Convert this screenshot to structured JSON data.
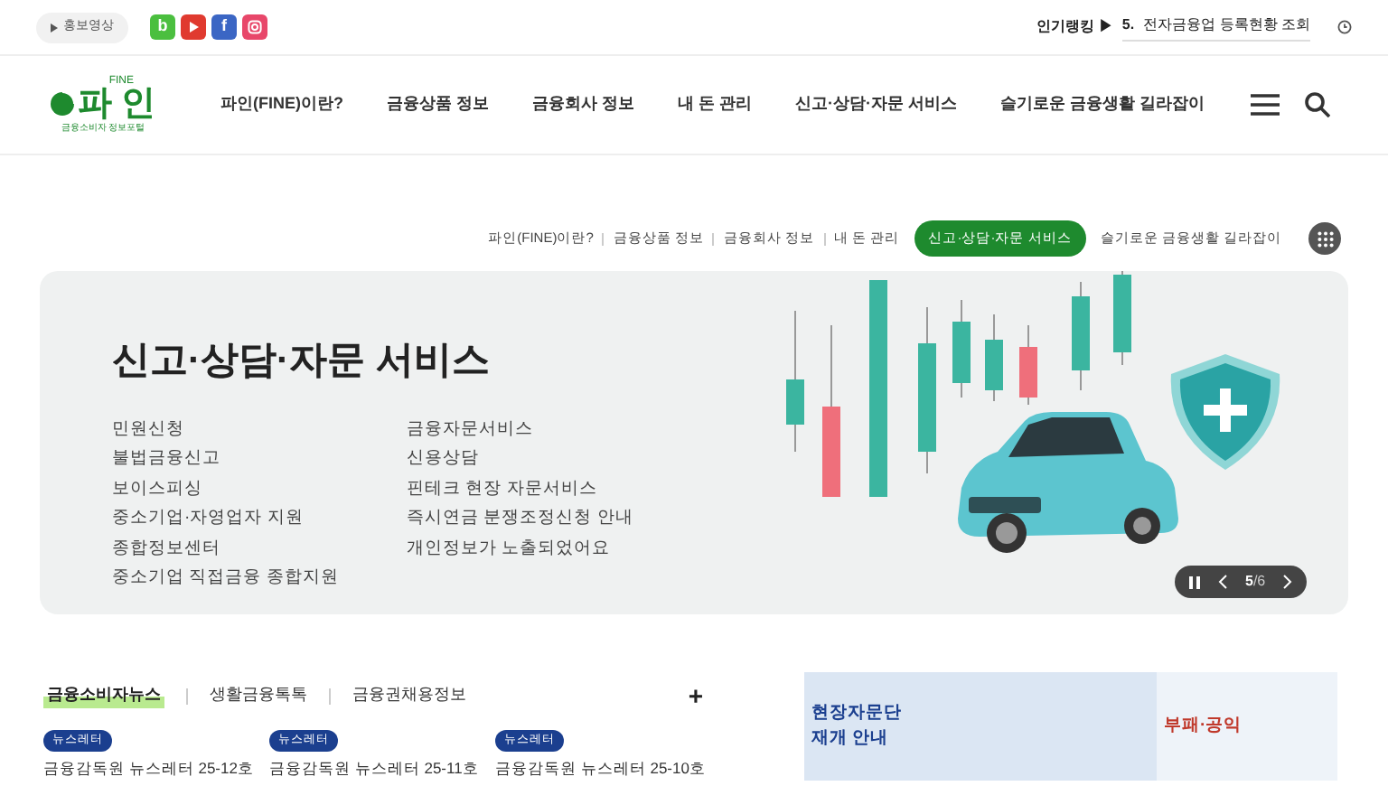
{
  "top_bar": {
    "promo_button": "홍보영상",
    "social": [
      {
        "kind": "blog",
        "label": "b"
      },
      {
        "kind": "youtube"
      },
      {
        "kind": "facebook",
        "label": "f"
      },
      {
        "kind": "instagram"
      }
    ],
    "ranking": {
      "label": "인기랭킹 ▶",
      "number": "5.",
      "text": "전자금융업 등록현황 조회"
    }
  },
  "header": {
    "logo": {
      "small": "FINE",
      "name": "파 인",
      "tagline": "금융소비자 정보포털"
    },
    "menu": [
      "파인(FINE)이란?",
      "금융상품 정보",
      "금융회사 정보",
      "내 돈 관리",
      "신고·상담·자문 서비스",
      "슬기로운 금융생활 길라잡이"
    ]
  },
  "quick_tabs": [
    {
      "label": "파인(FINE)이란?",
      "selected": false
    },
    {
      "label": "금융상품 정보",
      "selected": false
    },
    {
      "label": "금융회사 정보",
      "selected": false
    },
    {
      "label": "내 돈 관리",
      "selected": false
    },
    {
      "label": "신고·상담·자문 서비스",
      "selected": true
    },
    {
      "label": "슬기로운 금융생활 길라잡이",
      "selected": false
    }
  ],
  "hero": {
    "title": "신고·상담·자문 서비스",
    "links_left": [
      "민원신청",
      "불법금융신고",
      "보이스피싱",
      "중소기업·자영업자 지원",
      "종합정보센터",
      "중소기업 직접금융 종합지원"
    ],
    "links_right": [
      "금융자문서비스",
      "신용상담",
      "핀테크 현장 자문서비스",
      "즉시연금 분쟁조정신청 안내",
      "개인정보가 노출되었어요"
    ],
    "slide": {
      "current": "5",
      "total": "/6"
    }
  },
  "news": {
    "tabs": [
      {
        "label": "금융소비자뉴스",
        "selected": true
      },
      {
        "label": "생활금융톡톡",
        "selected": false
      },
      {
        "label": "금융권채용정보",
        "selected": false
      }
    ],
    "more": "+",
    "items": [
      {
        "badge": "뉴스레터",
        "title": "금융감독원 뉴스레터 25-12호"
      },
      {
        "badge": "뉴스레터",
        "title": "금융감독원 뉴스레터 25-11호"
      },
      {
        "badge": "뉴스레터",
        "title": "금융감독원 뉴스레터 25-10호"
      }
    ]
  },
  "banners": [
    {
      "lines": [
        "현장자문단",
        "재개 안내"
      ]
    },
    {
      "lines": [
        "부패·공익"
      ]
    }
  ]
}
